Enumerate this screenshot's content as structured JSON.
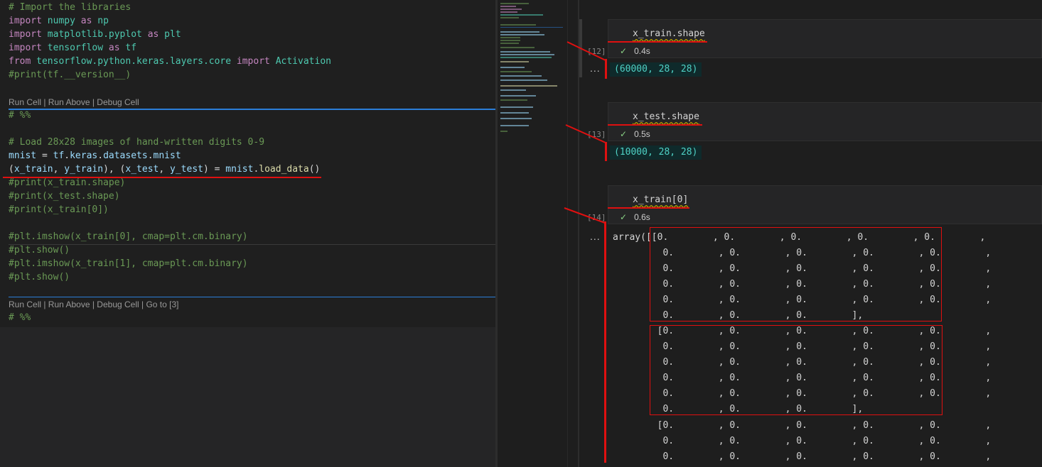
{
  "editor": {
    "cell1": {
      "lines": [
        "# Import the libraries",
        "import numpy as np",
        "import matplotlib.pyplot as plt",
        "import tensorflow as tf",
        "from tensorflow.python.keras.layers.core import Activation",
        "#print(tf.__version__)"
      ]
    },
    "codelens1": "Run Cell | Run Above | Debug Cell",
    "marker1": "# %%",
    "cell2": {
      "comment": "# Load 28x28 images of hand-written digits 0-9",
      "mnist_line": "mnist = tf.keras.datasets.mnist",
      "load_line": "(x_train, y_train), (x_test, y_test) = mnist.load_data()",
      "commented": [
        "#print(x_train.shape)",
        "#print(x_test.shape)",
        "#print(x_train[0])",
        "",
        "#plt.imshow(x_train[0], cmap=plt.cm.binary)",
        "#plt.show()",
        "#plt.imshow(x_train[1], cmap=plt.cm.binary)",
        "#plt.show()"
      ]
    },
    "codelens2": "Run Cell | Run Above | Debug Cell | Go to [3]",
    "marker2": "# %%"
  },
  "notebook": {
    "cells": [
      {
        "source": "x_train.shape",
        "count": "[12]",
        "time": "0.4s",
        "output": "(60000, 28, 28)"
      },
      {
        "source": "x_test.shape",
        "count": "[13]",
        "time": "0.5s",
        "output": "(10000, 28, 28)"
      },
      {
        "source": "x_train[0]",
        "count": "[14]",
        "time": "0.6s",
        "output_prefix": "array([["
      }
    ],
    "more_icon": "...",
    "check_icon": "check-icon",
    "array_rows": [
      "array([[0.        , 0.        , 0.        , 0.        , 0.        ,",
      "         0.        , 0.        , 0.        , 0.        , 0.        ,",
      "         0.        , 0.        , 0.        , 0.        , 0.        ,",
      "         0.        , 0.        , 0.        , 0.        , 0.        ,",
      "         0.        , 0.        , 0.        , 0.        , 0.        ,",
      "         0.        , 0.        , 0.        ],",
      "        [0.        , 0.        , 0.        , 0.        , 0.        ,",
      "         0.        , 0.        , 0.        , 0.        , 0.        ,",
      "         0.        , 0.        , 0.        , 0.        , 0.        ,",
      "         0.        , 0.        , 0.        , 0.        , 0.        ,",
      "         0.        , 0.        , 0.        , 0.        , 0.        ,",
      "         0.        , 0.        , 0.        ],",
      "        [0.        , 0.        , 0.        , 0.        , 0.        ,",
      "         0.        , 0.        , 0.        , 0.        , 0.        ,",
      "         0.        , 0.        , 0.        , 0.        , 0.        ,"
    ]
  },
  "colors": {
    "annotation_red": "#e01010",
    "output_teal": "#4fd1c5",
    "check_green": "#89d185"
  }
}
